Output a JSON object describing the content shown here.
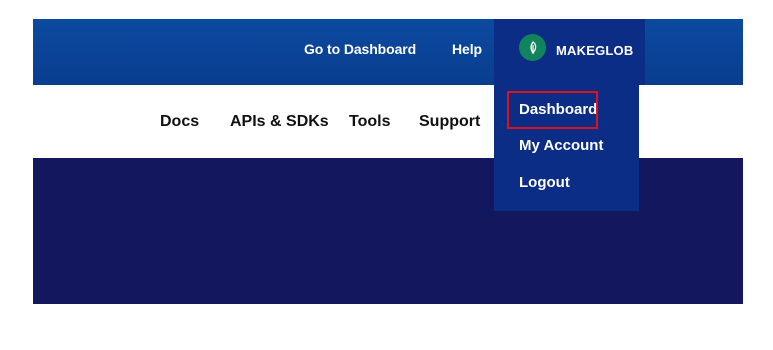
{
  "header": {
    "links": [
      {
        "label": "Go to Dashboard"
      },
      {
        "label": "Help"
      }
    ],
    "account": {
      "username": "MAKEGLOB",
      "avatar_icon": "leaf-icon",
      "avatar_color": "#11845e"
    }
  },
  "nav": {
    "items": [
      {
        "label": "Docs"
      },
      {
        "label": "APIs & SDKs"
      },
      {
        "label": "Tools"
      },
      {
        "label": "Support"
      }
    ]
  },
  "account_menu": {
    "items": [
      {
        "label": "Dashboard",
        "highlighted": true
      },
      {
        "label": "My Account"
      },
      {
        "label": "Logout"
      }
    ],
    "highlight_color": "#e0101c"
  },
  "colors": {
    "topbar": "#0b4aa0",
    "account_panel": "#0c2d86",
    "hero": "#13175e"
  }
}
